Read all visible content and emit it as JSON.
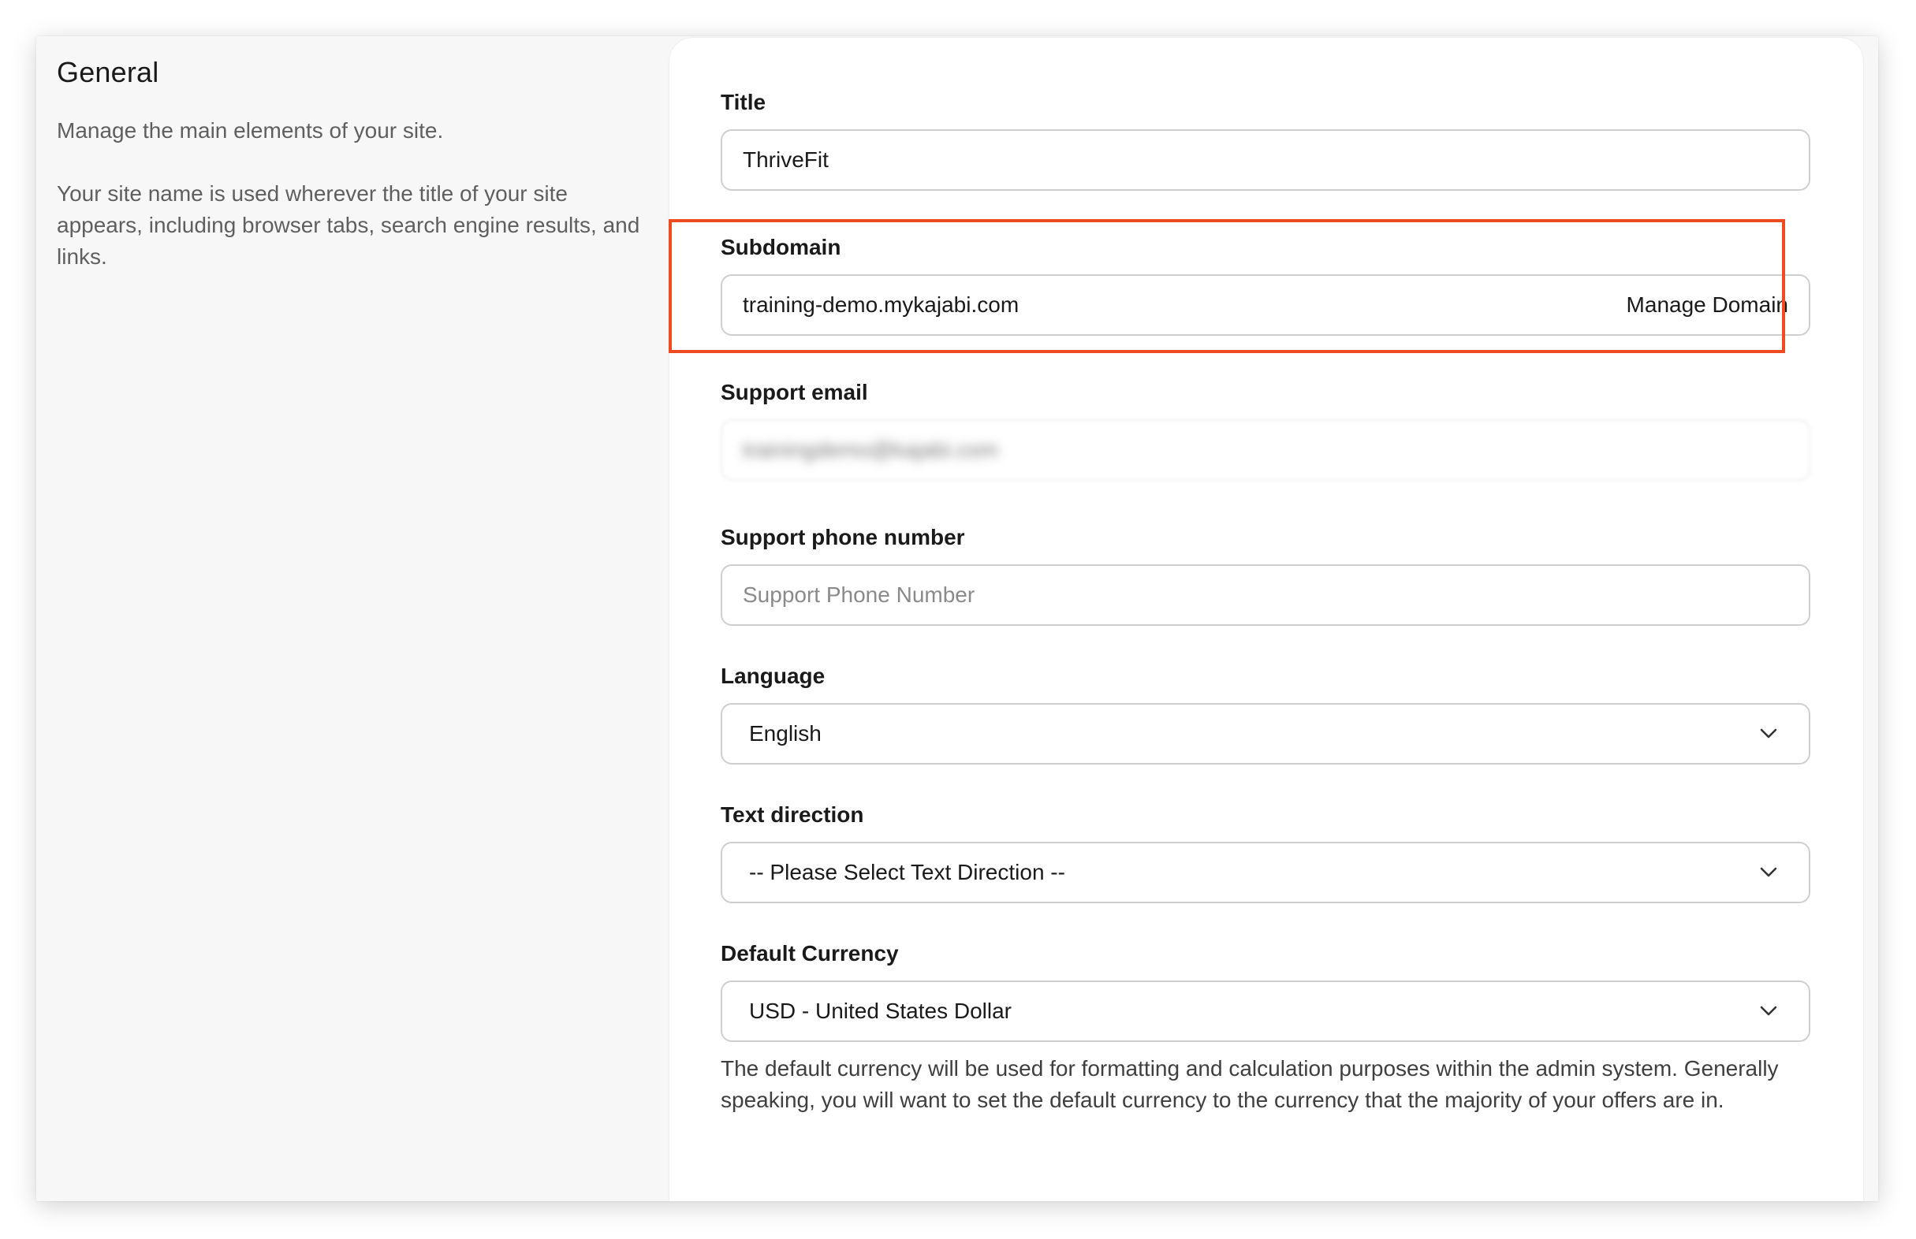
{
  "general": {
    "title": "General",
    "description_1": "Manage the main elements of your site.",
    "description_2": "Your site name is used wherever the title of your site appears, including browser tabs, search engine results, and links."
  },
  "form": {
    "title": {
      "label": "Title",
      "value": "ThriveFit"
    },
    "subdomain": {
      "label": "Subdomain",
      "value": "training-demo.mykajabi.com",
      "action": "Manage Domain"
    },
    "support_email": {
      "label": "Support email",
      "value": "trainingdemo@kajabi.com"
    },
    "support_phone": {
      "label": "Support phone number",
      "placeholder": "Support Phone Number"
    },
    "language": {
      "label": "Language",
      "selected": "English"
    },
    "text_direction": {
      "label": "Text direction",
      "selected": "-- Please Select Text Direction --"
    },
    "default_currency": {
      "label": "Default Currency",
      "selected": "USD - United States Dollar",
      "help": "The default currency will be used for formatting and calculation purposes within the admin system. Generally speaking, you will want to set the default currency to the currency that the majority of your offers are in."
    }
  },
  "icons": {
    "dropdown": "chevron-down-icon"
  },
  "colors": {
    "highlight": "#ee4b23",
    "panel_background": "#f7f7f7",
    "card_background": "#ffffff"
  }
}
